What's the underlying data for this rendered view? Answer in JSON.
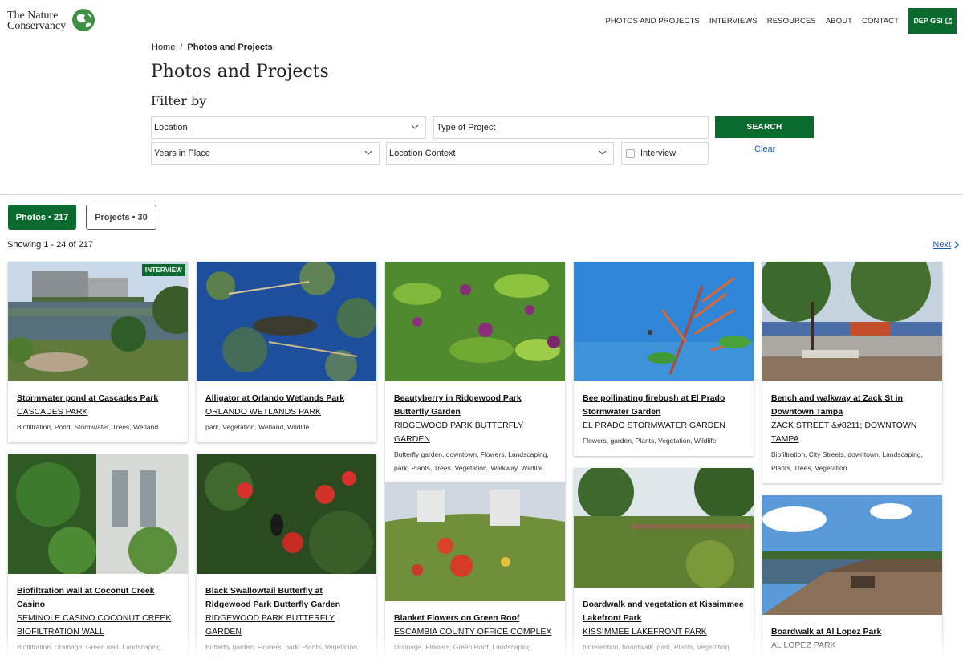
{
  "header": {
    "logo_line1": "The Nature",
    "logo_line2": "Conservancy",
    "nav": [
      "PHOTOS AND PROJECTS",
      "INTERVIEWS",
      "RESOURCES",
      "ABOUT",
      "CONTACT"
    ],
    "cta_label": "DEP GSI",
    "brand_color": "#0b6b2f"
  },
  "breadcrumb": {
    "home": "Home",
    "separator": "/",
    "current": "Photos and Projects"
  },
  "page_title": "Photos and Projects",
  "filter": {
    "heading": "Filter by",
    "location": "Location",
    "type_of_project": "Type of Project",
    "years_in_place": "Years in Place",
    "location_context": "Location Context",
    "interview": "Interview",
    "search_label": "SEARCH",
    "clear_label": "Clear"
  },
  "tabs": {
    "photos": "Photos • 217",
    "projects": "Projects • 30"
  },
  "results": {
    "showing": "Showing 1 - 24 of 217",
    "next": "Next"
  },
  "cards": [
    {
      "title": "Stormwater pond at Cascades Park",
      "location": "CASCADES PARK",
      "tags": "Biofiltration, Pond, Stormwater, Trees, Wetland",
      "badge": "INTERVIEW",
      "image": "pond-park-photo"
    },
    {
      "title": "Alligator at Orlando Wetlands Park",
      "location": "ORLANDO WETLANDS PARK",
      "tags": "park, Vegetation, Wetland, Wildlife",
      "badge": "",
      "image": "alligator-photo"
    },
    {
      "title": "Beautyberry in Ridgewood Park Butterfly Garden",
      "location": "RIDGEWOOD PARK BUTTERFLY GARDEN",
      "tags": "Butterfly garden, downtown, Flowers, Landscaping, park, Plants, Trees, Vegetation, Walkway, Wildlife",
      "badge": "",
      "image": "beautyberry-photo"
    },
    {
      "title": "Bee pollinating firebush at El Prado Stormwater Garden",
      "location": "EL PRADO STORMWATER GARDEN",
      "tags": "Flowers, garden, Plants, Vegetation, Wildlife",
      "badge": "",
      "image": "firebush-photo"
    },
    {
      "title": "Bench and walkway at Zack St in Downtown Tampa",
      "location": "ZACK STREET &#8211; DOWNTOWN TAMPA",
      "tags": "Biofiltration, City Streets, downtown, Landscaping, Plants, Trees, Vegetation",
      "badge": "",
      "image": "bench-walkway-photo"
    },
    {
      "title": "Biofiltration wall at Coconut Creek Casino",
      "location": "SEMINOLE CASINO COCONUT CREEK BIOFILTRATION WALL",
      "tags": "Biofiltration, Drainage, Green wall, Landscaping,",
      "badge": "",
      "image": "green-wall-photo"
    },
    {
      "title": "Black Swallowtail Butterfly at Ridgewood Park Butterfly Garden",
      "location": "RIDGEWOOD PARK BUTTERFLY GARDEN",
      "tags": "Butterfly garden, Flowers, park, Plants, Vegetation, Wildlife",
      "badge": "",
      "image": "swallowtail-photo"
    },
    {
      "title": "Blanket Flowers on Green Roof",
      "location": "ESCAMBIA COUNTY OFFICE COMPLEX",
      "tags": "Drainage, Flowers, Green Roof, Landscaping,",
      "badge": "",
      "image": "green-roof-photo"
    },
    {
      "title": "Boardwalk and vegetation at Kissimmee Lakefront Park",
      "location": "KISSIMMEE LAKEFRONT PARK",
      "tags": "bioretention, boardwalk, park, Plants, Vegetation,",
      "badge": "",
      "image": "boardwalk-vegetation-photo"
    },
    {
      "title": "Boardwalk at Al Lopez Park",
      "location": "AL LOPEZ PARK",
      "tags": "",
      "badge": "",
      "image": "boardwalk-lake-photo"
    }
  ]
}
